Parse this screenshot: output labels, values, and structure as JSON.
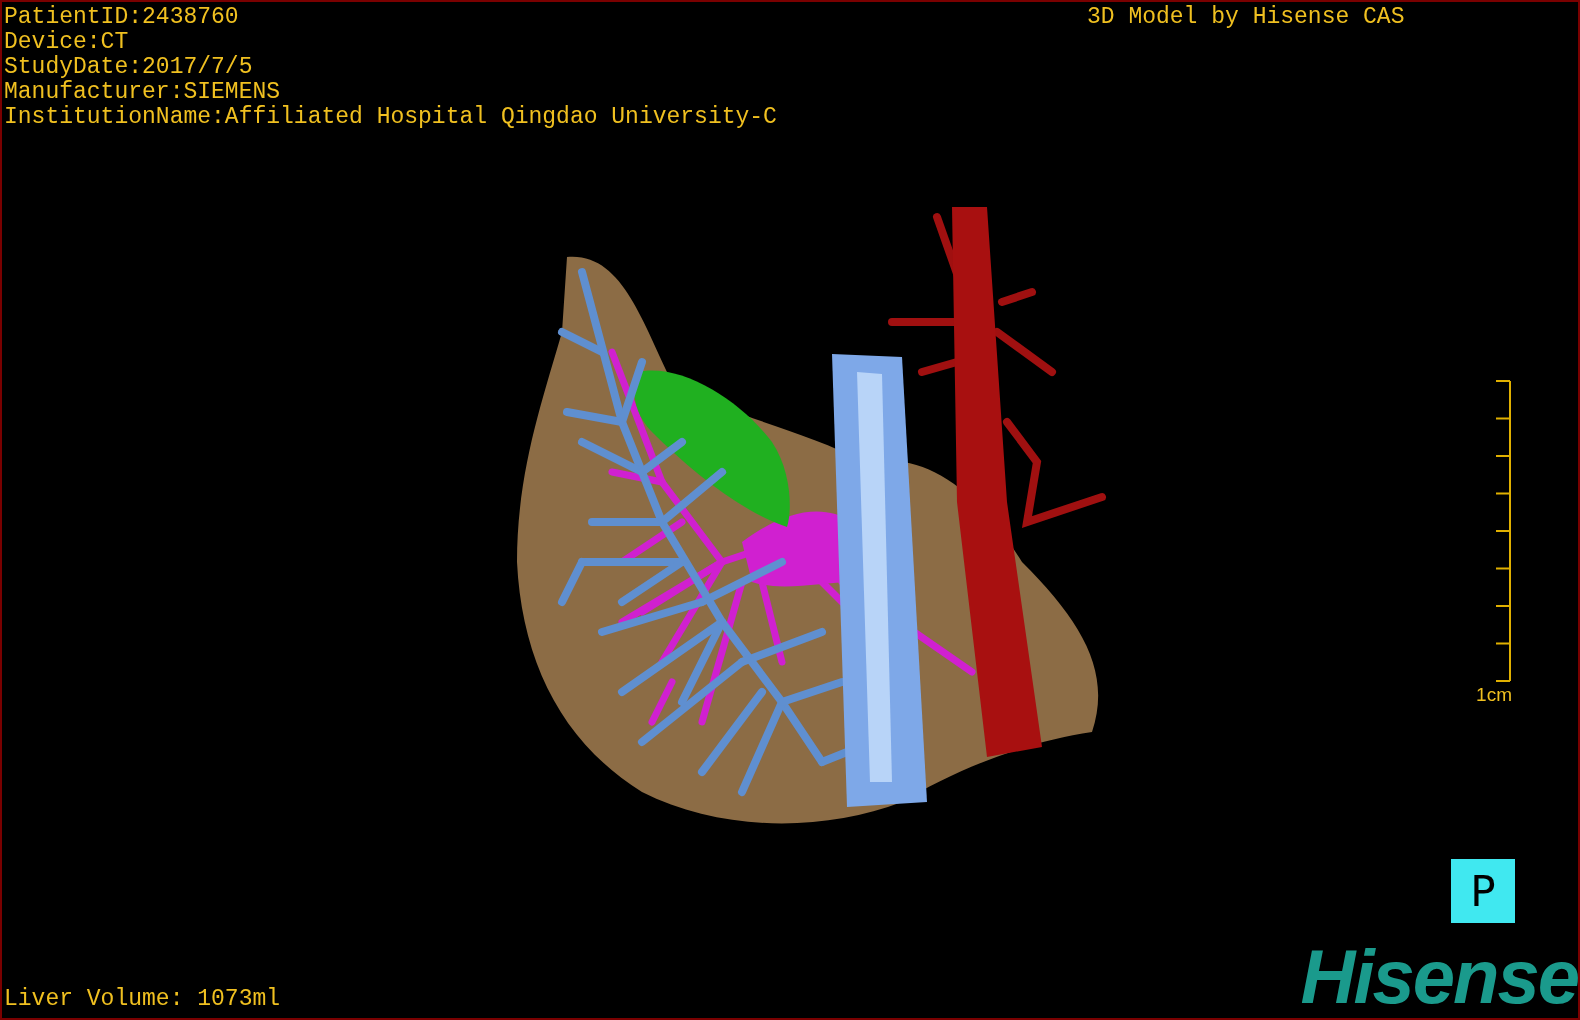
{
  "overlay": {
    "info_lines": [
      "PatientID:2438760",
      "Device:CT",
      "StudyDate:2017/7/5",
      "Manufacturer:SIEMENS",
      "InstitutionName:Affiliated Hospital Qingdao University-C"
    ],
    "credit": "3D Model by Hisense CAS"
  },
  "scale_bar": {
    "label": "1cm"
  },
  "orientation_marker": {
    "label": "P"
  },
  "liver_volume": "Liver Volume: 1073ml",
  "logo": {
    "text": "Hisense"
  }
}
